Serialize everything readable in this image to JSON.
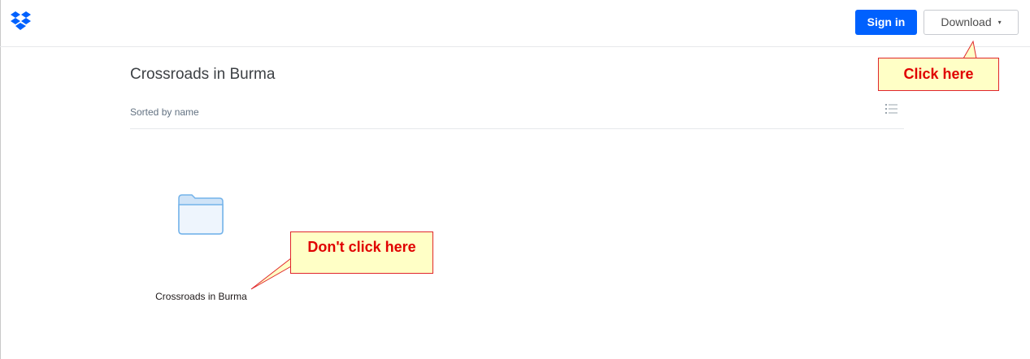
{
  "header": {
    "logo_name": "dropbox-logo",
    "sign_in_label": "Sign in",
    "download_label": "Download",
    "download_caret": "▾"
  },
  "main": {
    "title": "Crossroads in Burma",
    "sort_label": "Sorted by name",
    "items": [
      {
        "name": "Crossroads in Burma",
        "type": "folder"
      }
    ]
  },
  "annotations": {
    "click_here": "Click here",
    "dont_click_here": "Don't click here"
  },
  "colors": {
    "brand_blue": "#0061fe",
    "callout_bg": "#ffffc6",
    "callout_text": "#e00000",
    "folder_blue": "#74b3ea"
  }
}
